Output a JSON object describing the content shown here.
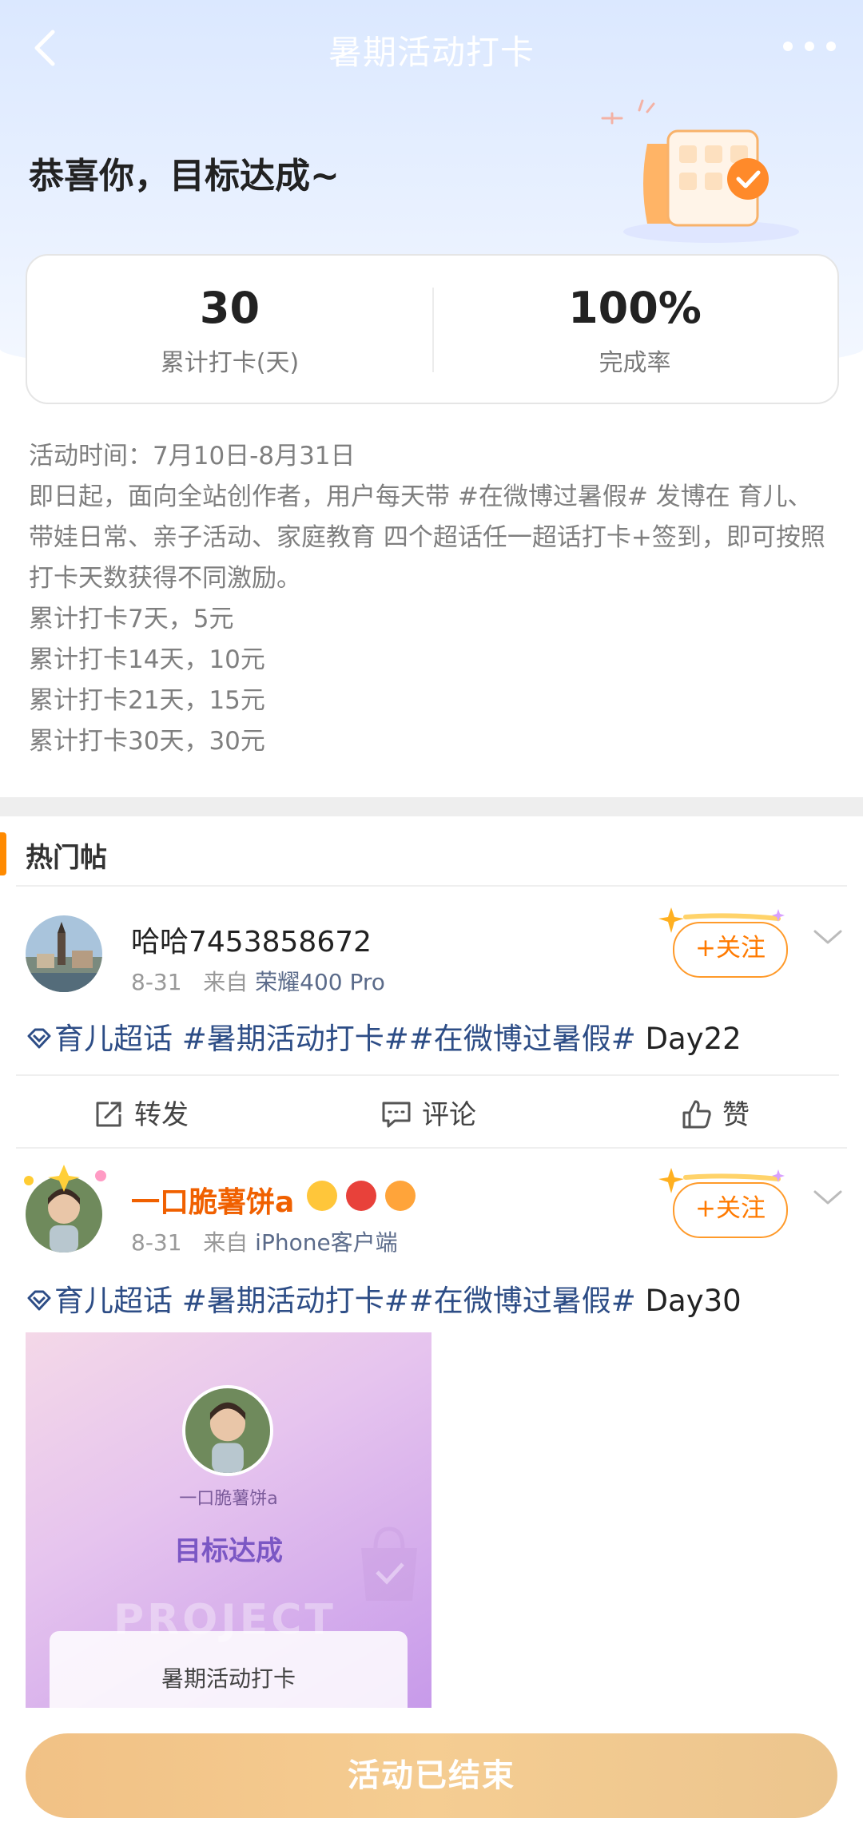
{
  "header": {
    "title": "暑期活动打卡",
    "back_icon": "chevron-left-icon",
    "more_icon": "more-horizontal-icon"
  },
  "hero": {
    "congrats": "恭喜你，目标达成~",
    "illustration": "checklist-calendar-illustration"
  },
  "stats": [
    {
      "value": "30",
      "label": "累计打卡(天)"
    },
    {
      "value": "100%",
      "label": "完成率"
    }
  ],
  "description": {
    "time": "活动时间：7月10日-8月31日",
    "body": "即日起，面向全站创作者，用户每天带 #在微博过暑假# 发博在 育儿、带娃日常、亲子活动、家庭教育 四个超话任一超话打卡+签到，即可按照打卡天数获得不同激励。",
    "rewards": [
      "累计打卡7天，5元",
      "累计打卡14天，10元",
      "累计打卡21天，15元",
      "累计打卡30天，30元"
    ]
  },
  "section": {
    "title": "热门帖"
  },
  "posts": [
    {
      "username": "哈哈7453858672",
      "date": "8-31",
      "from_label": "来自",
      "source": "荣耀400 Pro",
      "follow_label": "+关注",
      "topic_link": "育儿超话",
      "hashtags": " #暑期活动打卡##在微博过暑假#",
      "day": " Day22",
      "actions": {
        "repost": "转发",
        "comment": "评论",
        "like": "赞"
      }
    },
    {
      "username": "一口脆薯饼a",
      "date": "8-31",
      "from_label": "来自",
      "source": "iPhone客户端",
      "follow_label": "+关注",
      "topic_link": "育儿超话",
      "hashtags": " #暑期活动打卡##在微博过暑假#",
      "day": " Day30",
      "image": {
        "name": "一口脆薯饼a",
        "goal": "目标达成",
        "ghost_text": "PROJECT",
        "card_title": "暑期活动打卡"
      }
    }
  ],
  "footer": {
    "button_label": "活动已结束"
  },
  "colors": {
    "accent_orange": "#ff8a00",
    "vip_name": "#f06000",
    "link_blue": "#2d4d86",
    "button_gold": "#f1c185"
  }
}
